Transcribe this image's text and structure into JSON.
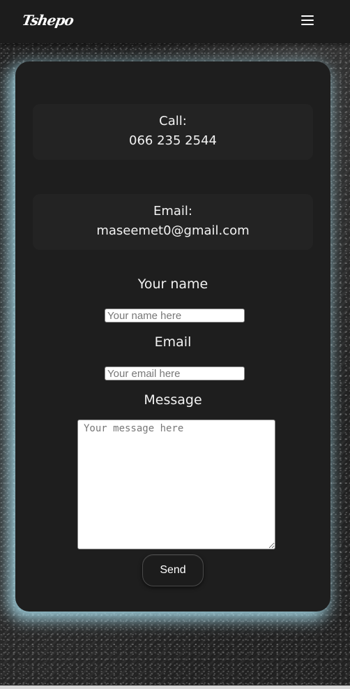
{
  "navbar": {
    "logo_text": "Tshepo",
    "menu_icon": "hamburger-menu-icon"
  },
  "contact": {
    "call_label": "Call:",
    "call_value": "066 235 2544",
    "email_label": "Email:",
    "email_value": "maseemet0@gmail.com"
  },
  "form": {
    "name_label": "Your name",
    "name_placeholder": "Your name here",
    "email_label": "Email",
    "email_placeholder": "Your email here",
    "message_label": "Message",
    "message_placeholder": "Your message here",
    "send_label": "Send"
  },
  "colors": {
    "card_glow": "#aae1f0",
    "card_background": "#1e1e1e",
    "navbar_background": "#1c1c1c"
  }
}
